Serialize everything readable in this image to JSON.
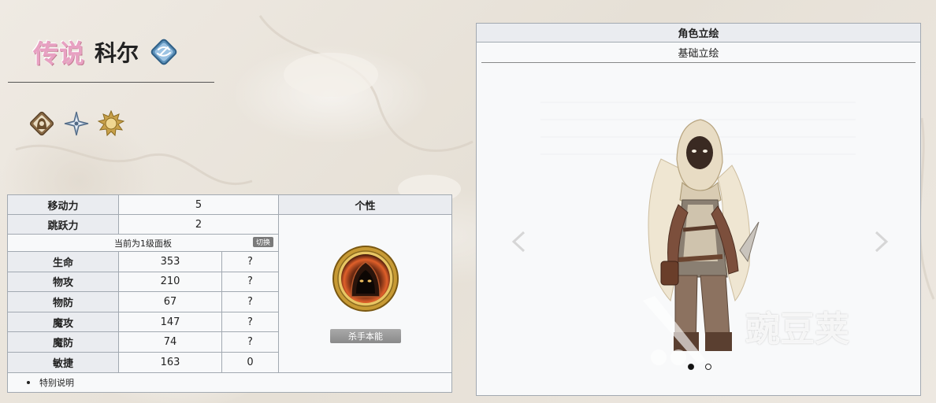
{
  "header": {
    "rarity": "传说",
    "name": "科尔",
    "element_icon": "wind-element-icon"
  },
  "traits": [
    {
      "icon": "hooded-assassin-class-icon",
      "color": "#8a6a45"
    },
    {
      "icon": "star-compass-icon",
      "color": "#6f89a6"
    },
    {
      "icon": "sun-emblem-icon",
      "color": "#c7a04a"
    }
  ],
  "stats_table": {
    "move": {
      "label": "移动力",
      "value": "5"
    },
    "jump": {
      "label": "跳跃力",
      "value": "2"
    },
    "panel_note": "当前为1级面板",
    "switch_label": "切换",
    "rows": [
      {
        "label": "生命",
        "value": "353",
        "growth": "?"
      },
      {
        "label": "物攻",
        "value": "210",
        "growth": "?"
      },
      {
        "label": "物防",
        "value": "67",
        "growth": "?"
      },
      {
        "label": "魔攻",
        "value": "147",
        "growth": "?"
      },
      {
        "label": "魔防",
        "value": "74",
        "growth": "?"
      },
      {
        "label": "敏捷",
        "value": "163",
        "growth": "0"
      }
    ],
    "personality_header": "个性",
    "personality_name": "杀手本能",
    "note_item": "特别说明"
  },
  "portrait": {
    "title": "角色立绘",
    "tab": "基础立绘",
    "watermark": "豌豆荚",
    "slide_index": 0,
    "slide_count": 2
  },
  "colors": {
    "border": "#a2a9b1",
    "header_bg": "#eaecf0",
    "rarity_pink": "#e8a0c2",
    "element_blue": "#5a8fb8"
  }
}
